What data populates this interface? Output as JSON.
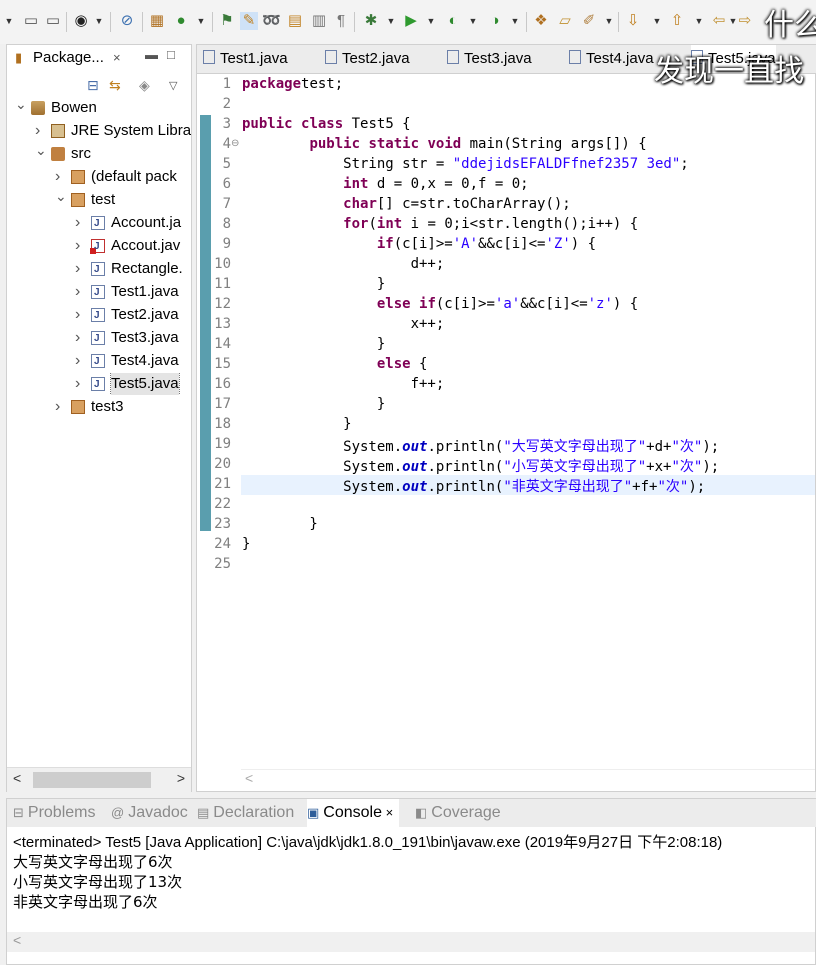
{
  "overlay": {
    "line1": "什么",
    "line2": "发现一直找"
  },
  "package_explorer": {
    "title": "Package...",
    "close": "×",
    "tree": [
      {
        "label": "Bowen",
        "kind": "project",
        "level": 0,
        "twisty": "v"
      },
      {
        "label": "JRE System Libra",
        "kind": "lib",
        "level": 1,
        "twisty": ">"
      },
      {
        "label": "src",
        "kind": "src",
        "level": 1,
        "twisty": "v"
      },
      {
        "label": "(default pack",
        "kind": "pkg",
        "level": 2,
        "twisty": ">"
      },
      {
        "label": "test",
        "kind": "pkg",
        "level": 2,
        "twisty": "v"
      },
      {
        "label": "Account.ja",
        "kind": "java",
        "level": 3,
        "twisty": ">"
      },
      {
        "label": "Accout.jav",
        "kind": "java-error",
        "level": 3,
        "twisty": ">"
      },
      {
        "label": "Rectangle.",
        "kind": "java",
        "level": 3,
        "twisty": ">"
      },
      {
        "label": "Test1.java",
        "kind": "java",
        "level": 3,
        "twisty": ">"
      },
      {
        "label": "Test2.java",
        "kind": "java",
        "level": 3,
        "twisty": ">"
      },
      {
        "label": "Test3.java",
        "kind": "java",
        "level": 3,
        "twisty": ">"
      },
      {
        "label": "Test4.java",
        "kind": "java",
        "level": 3,
        "twisty": ">"
      },
      {
        "label": "Test5.java",
        "kind": "java",
        "level": 3,
        "twisty": ">",
        "selected": true
      },
      {
        "label": "test3",
        "kind": "pkg",
        "level": 2,
        "twisty": ">"
      }
    ]
  },
  "editor": {
    "tabs": [
      "Test1.java",
      "Test2.java",
      "Test3.java",
      "Test4.java",
      "Test5.java"
    ],
    "active_tab": "Test5.java",
    "current_line": 21,
    "lines": [
      [
        [
          "kw",
          "package"
        ],
        [
          "",
          "test;"
        ]
      ],
      [],
      [
        [
          "kw",
          "public"
        ],
        [
          "",
          " "
        ],
        [
          "kw",
          "class"
        ],
        [
          "",
          " Test5 {"
        ]
      ],
      [
        [
          "",
          "        "
        ],
        [
          "kw",
          "public"
        ],
        [
          "",
          " "
        ],
        [
          "kw",
          "static"
        ],
        [
          "",
          " "
        ],
        [
          "kw",
          "void"
        ],
        [
          "",
          " main(String args[]) {"
        ]
      ],
      [
        [
          "",
          "            String str = "
        ],
        [
          "str",
          "\"ddejidsEFALDFfnef2357 3ed\""
        ],
        [
          "",
          ";"
        ]
      ],
      [
        [
          "",
          "            "
        ],
        [
          "kw",
          "int"
        ],
        [
          "",
          " d = 0,x = 0,f = 0;"
        ]
      ],
      [
        [
          "",
          "            "
        ],
        [
          "kw",
          "char"
        ],
        [
          "",
          "[] c=str.toCharArray();"
        ]
      ],
      [
        [
          "",
          "            "
        ],
        [
          "kw",
          "for"
        ],
        [
          "",
          "("
        ],
        [
          "kw",
          "int"
        ],
        [
          "",
          " i = 0;i<str.length();i++) {"
        ]
      ],
      [
        [
          "",
          "                "
        ],
        [
          "kw",
          "if"
        ],
        [
          "",
          "(c[i]>="
        ],
        [
          "str",
          "'A'"
        ],
        [
          "",
          "&&c[i]<="
        ],
        [
          "str",
          "'Z'"
        ],
        [
          "",
          ") {"
        ]
      ],
      [
        [
          "",
          "                    d++;"
        ]
      ],
      [
        [
          "",
          "                }"
        ]
      ],
      [
        [
          "",
          "                "
        ],
        [
          "kw",
          "else"
        ],
        [
          "",
          " "
        ],
        [
          "kw",
          "if"
        ],
        [
          "",
          "(c[i]>="
        ],
        [
          "str",
          "'a'"
        ],
        [
          "",
          "&&c[i]<="
        ],
        [
          "str",
          "'z'"
        ],
        [
          "",
          ") {"
        ]
      ],
      [
        [
          "",
          "                    x++;"
        ]
      ],
      [
        [
          "",
          "                }"
        ]
      ],
      [
        [
          "",
          "                "
        ],
        [
          "kw",
          "else"
        ],
        [
          "",
          " {"
        ]
      ],
      [
        [
          "",
          "                    f++;"
        ]
      ],
      [
        [
          "",
          "                }"
        ]
      ],
      [
        [
          "",
          "            }"
        ]
      ],
      [
        [
          "",
          "            System."
        ],
        [
          "fld",
          "out"
        ],
        [
          "",
          ".println("
        ],
        [
          "str",
          "\"大写英文字母出现了\""
        ],
        [
          "",
          "+d+"
        ],
        [
          "str",
          "\"次\""
        ],
        [
          "",
          ");"
        ]
      ],
      [
        [
          "",
          "            System."
        ],
        [
          "fld",
          "out"
        ],
        [
          "",
          ".println("
        ],
        [
          "str",
          "\"小写英文字母出现了\""
        ],
        [
          "",
          "+x+"
        ],
        [
          "str",
          "\"次\""
        ],
        [
          "",
          ");"
        ]
      ],
      [
        [
          "",
          "            System."
        ],
        [
          "fld",
          "out"
        ],
        [
          "",
          ".println("
        ],
        [
          "str",
          "\"非英文字母出现了\""
        ],
        [
          "",
          "+f+"
        ],
        [
          "str",
          "\"次\""
        ],
        [
          "",
          ");"
        ]
      ],
      [],
      [
        [
          "",
          "        }"
        ]
      ],
      [
        [
          "",
          "}"
        ]
      ],
      []
    ]
  },
  "console": {
    "tabs": [
      {
        "label": "Problems",
        "icon": "problems-icon"
      },
      {
        "label": "Javadoc",
        "icon": "javadoc-icon"
      },
      {
        "label": "Declaration",
        "icon": "declaration-icon"
      },
      {
        "label": "Console",
        "icon": "console-icon",
        "active": true
      },
      {
        "label": "Coverage",
        "icon": "coverage-icon"
      }
    ],
    "header": "<terminated> Test5 [Java Application] C:\\java\\jdk\\jdk1.8.0_191\\bin\\javaw.exe (2019年9月27日 下午2:08:18)",
    "output": [
      "大写英文字母出现了6次",
      "小写英文字母出现了13次",
      "非英文字母出现了6次"
    ]
  }
}
